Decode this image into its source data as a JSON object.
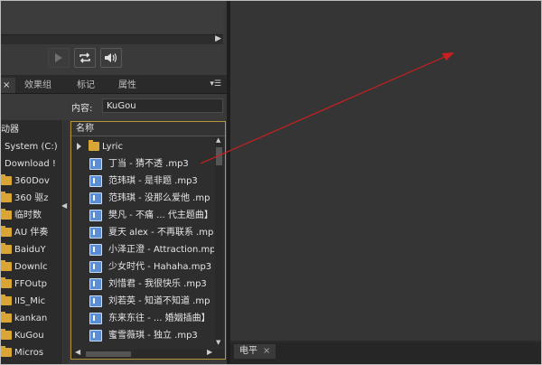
{
  "colors": {
    "accent_border": "#b8953a",
    "folder": "#d9a535",
    "arrow": "#cc1f1f"
  },
  "transport": {
    "play_icon": "play-icon",
    "loop_icon": "loop-icon",
    "volume_icon": "volume-icon"
  },
  "panel": {
    "tabs": [
      {
        "label": "",
        "close": "×"
      },
      {
        "label": "效果组"
      },
      {
        "label": "标记"
      },
      {
        "label": "属性"
      }
    ],
    "menu_glyph": "▾☰",
    "content_label": "内容:",
    "content_value": "KuGou"
  },
  "tree": {
    "items": [
      {
        "label": "动器"
      },
      {
        "label": "System (C:)"
      },
      {
        "label": "Download !"
      },
      {
        "label": "360Dov"
      },
      {
        "label": "360 驱z"
      },
      {
        "label": "临时数"
      },
      {
        "label": "AU 伴奏"
      },
      {
        "label": "BaiduY"
      },
      {
        "label": "Downlc"
      },
      {
        "label": "FFOutp"
      },
      {
        "label": "IIS_Mic"
      },
      {
        "label": "kankan"
      },
      {
        "label": "KuGou"
      },
      {
        "label": "Micros"
      }
    ]
  },
  "filelist": {
    "header": "名称",
    "rows": [
      {
        "name": "Lyric",
        "type": "folder"
      },
      {
        "name": "丁当 - 猜不透 .mp3",
        "type": "mp3"
      },
      {
        "name": "范玮琪 - 是非题 .mp3",
        "type": "mp3"
      },
      {
        "name": "范玮琪 - 没那么爱他 .mp",
        "type": "mp3"
      },
      {
        "name": "樊凡 - 不痛 ... 代主题曲】",
        "type": "mp3"
      },
      {
        "name": "夏天 alex - 不再联系 .mp",
        "type": "mp3"
      },
      {
        "name": "小泽正澄 - Attraction.mp",
        "type": "mp3"
      },
      {
        "name": "少女时代 - Hahaha.mp3",
        "type": "mp3"
      },
      {
        "name": "刘惜君 - 我很快乐 .mp3",
        "type": "mp3"
      },
      {
        "name": "刘若英 - 知道不知道 .mp",
        "type": "mp3"
      },
      {
        "name": "东来东往 - ... 婚姻插曲】",
        "type": "mp3"
      },
      {
        "name": "蜜雪薇琪 - 独立 .mp3",
        "type": "mp3"
      }
    ]
  },
  "bottom_tab": {
    "label": "电平",
    "close": "×"
  }
}
